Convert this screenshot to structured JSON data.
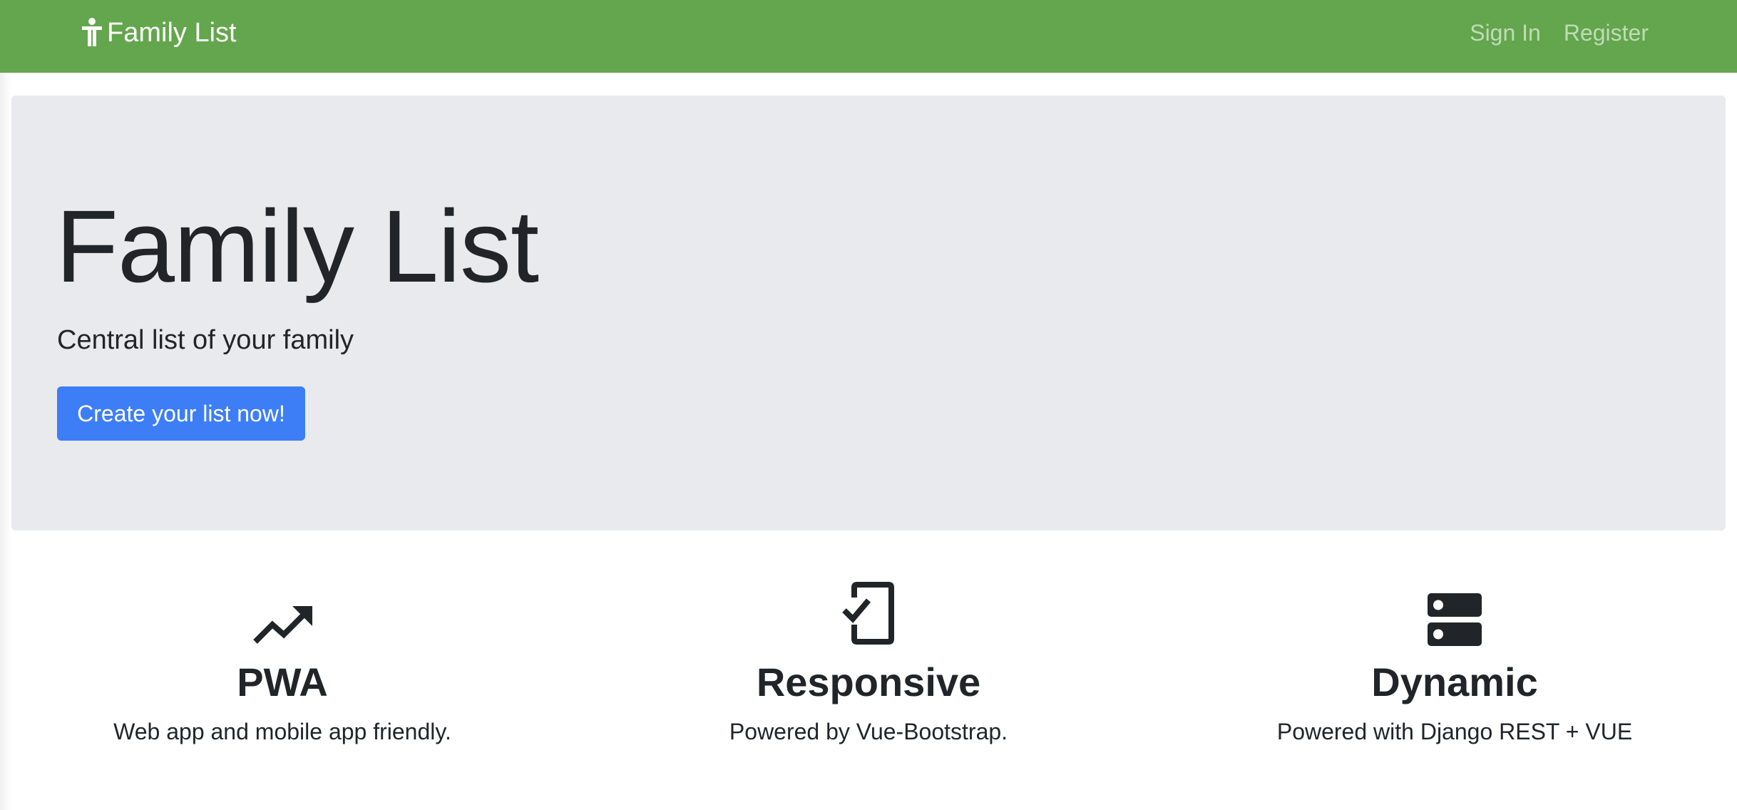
{
  "navbar": {
    "brand": "Family List",
    "links": [
      {
        "label": "Sign In"
      },
      {
        "label": "Register"
      }
    ],
    "background": "#63a64d"
  },
  "hero": {
    "title": "Family List",
    "lead": "Central list of your family",
    "cta_label": "Create your list now!",
    "cta_color": "#3d7ef7"
  },
  "features": [
    {
      "icon": "trending-up-icon",
      "title": "PWA",
      "text": "Web app and mobile app friendly."
    },
    {
      "icon": "phone-check-icon",
      "title": "Responsive",
      "text": "Powered by Vue-Bootstrap."
    },
    {
      "icon": "server-icon",
      "title": "Dynamic",
      "text": "Powered with Django REST + VUE"
    }
  ]
}
